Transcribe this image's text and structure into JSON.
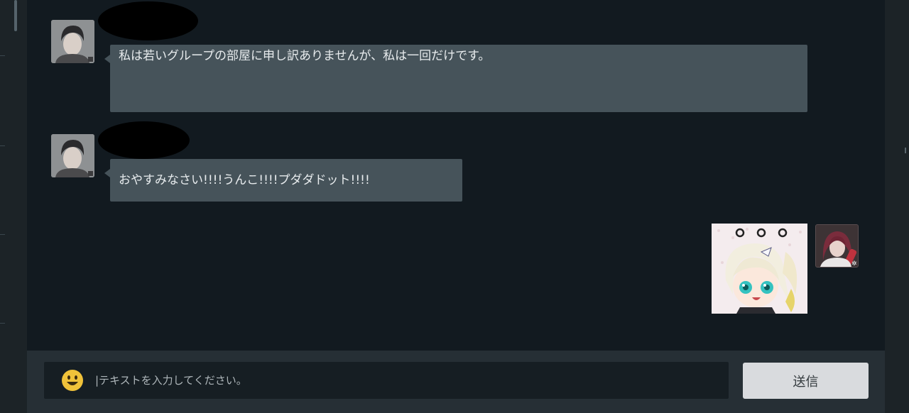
{
  "messages": [
    {
      "text": "私は若いグループの部屋に申し訳ありませんが、私は一回だけです。",
      "sender": "other",
      "avatar": "male-character-portrait"
    },
    {
      "text": "おやすみなさい!!!!うんこ!!!!プダダドット!!!!",
      "sender": "other",
      "avatar": "male-character-portrait"
    },
    {
      "sender": "self",
      "sticker": "chibi-blonde-girl-sticker",
      "avatar": "red-haired-character-portrait"
    }
  ],
  "input": {
    "placeholder": "|テキストを入力してください。",
    "value": ""
  },
  "send_button": {
    "label": "送信"
  },
  "icons": {
    "emoji": "smiley-face-icon"
  },
  "colors": {
    "chat_background": "#121a20",
    "bubble": "#46535a",
    "input_bar": "#262f35",
    "send_button": "#d9dbde",
    "emoji": "#f0c23a"
  }
}
